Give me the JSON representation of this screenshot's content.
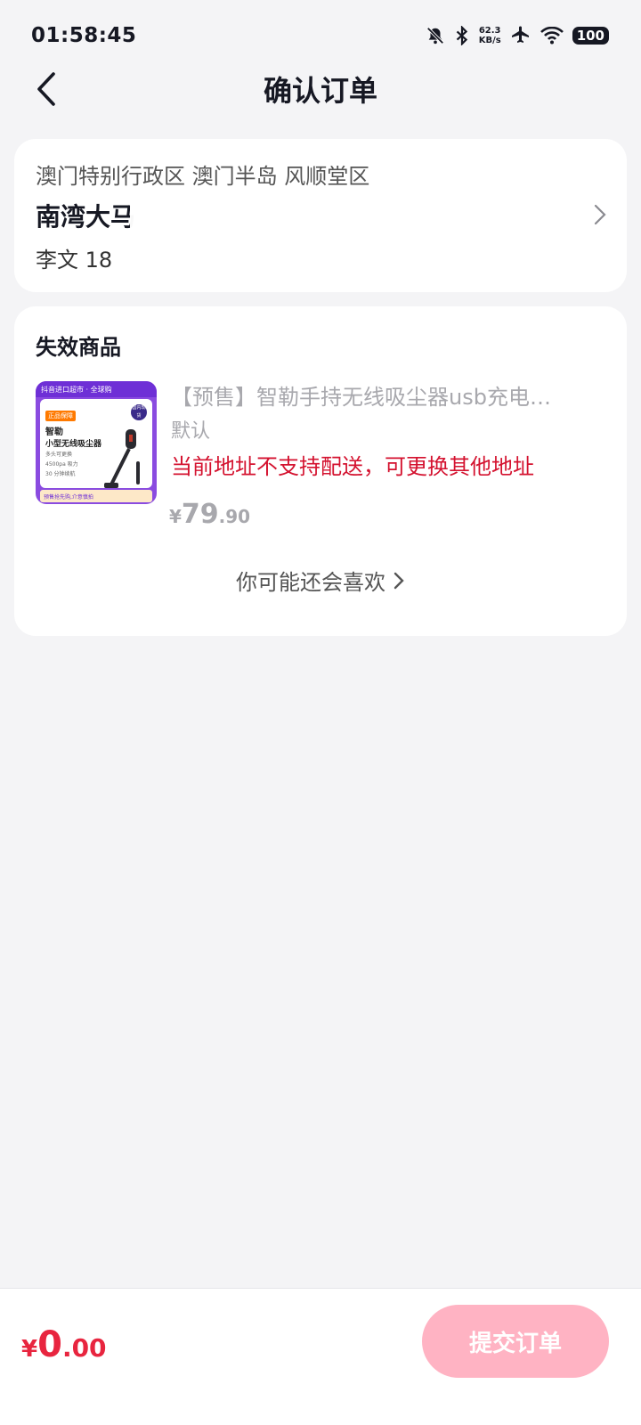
{
  "status_bar": {
    "time": "01:58:45",
    "net_speed_value": "62.3",
    "net_speed_unit": "KB/s",
    "battery": "100"
  },
  "nav": {
    "title": "确认订单"
  },
  "address": {
    "region": "澳门特别行政区 澳门半岛 风顺堂区",
    "street": "南湾大马",
    "contact": "李文 18"
  },
  "goods": {
    "section_title": "失效商品",
    "thumbnail": {
      "top_banner": "抖音进口超市 · 全球购",
      "tag": "正品保障",
      "brand": "智勒",
      "name": "小型无线吸尘器",
      "features": [
        "多头可更换",
        "4500pa 吸力",
        "30 分钟续航"
      ],
      "badge": "国内现货",
      "strip": "预售抢先购,介意慎拍"
    },
    "title": "【预售】智勒手持无线吸尘器usb充电…",
    "spec": "默认",
    "warning": "当前地址不支持配送，可更换其他地址",
    "price_symbol": "¥",
    "price_int": "79",
    "price_dec": ".90",
    "recommend_label": "你可能还会喜欢"
  },
  "bottom": {
    "total_symbol": "¥",
    "total_int": "0",
    "total_dec": ".00",
    "submit_label": "提交订单"
  },
  "colors": {
    "accent_red": "#e8253f",
    "warning_red": "#d4122f",
    "submit_disabled": "#ffb3c3",
    "background": "#f4f4f6"
  },
  "icons": [
    "back-arrow-icon",
    "mute-bell-icon",
    "bluetooth-icon",
    "airplane-icon",
    "wifi-icon",
    "chevron-right-icon"
  ]
}
